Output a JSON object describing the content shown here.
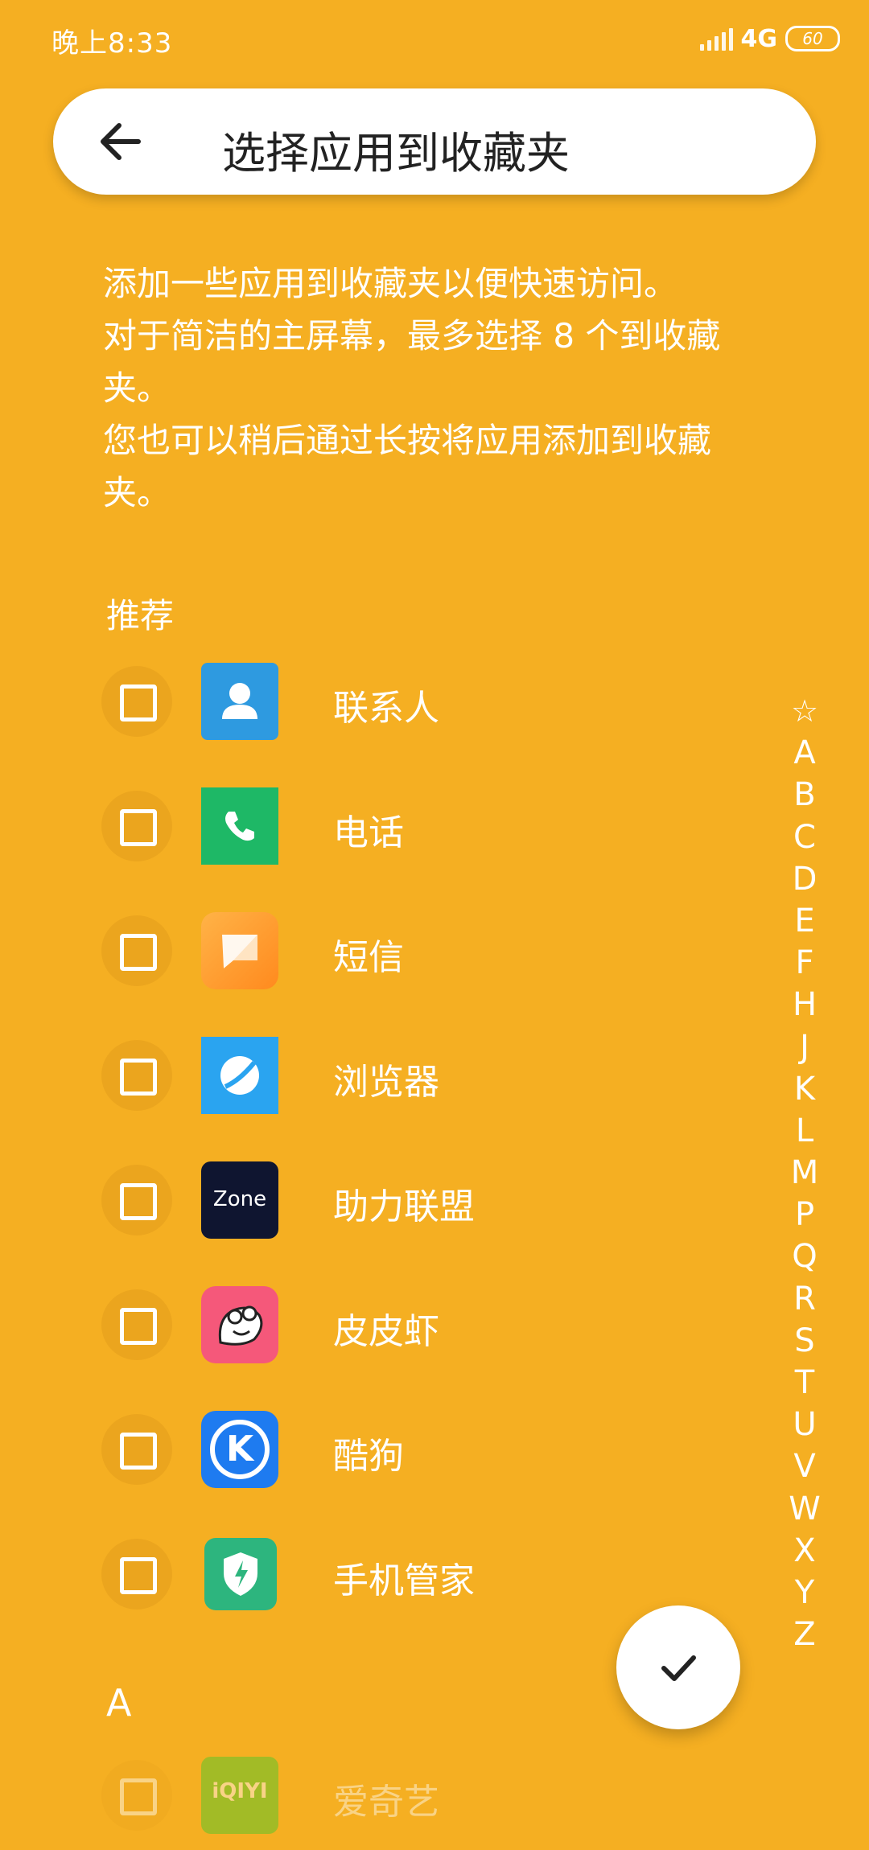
{
  "status_bar": {
    "time": "晚上8:33",
    "network": "4G",
    "battery": "60"
  },
  "header": {
    "title": "选择应用到收藏夹"
  },
  "description": {
    "line1": "添加一些应用到收藏夹以便快速访问。",
    "line2": "对于简洁的主屏幕，最多选择 8 个到收藏夹。",
    "line3": "您也可以稍后通过长按将应用添加到收藏夹。"
  },
  "sections": {
    "recommended": "推荐",
    "a": "A"
  },
  "apps": [
    {
      "label": "联系人",
      "icon": "contacts-icon",
      "color": "#2E9AE0"
    },
    {
      "label": "电话",
      "icon": "phone-icon",
      "color": "#1EB866"
    },
    {
      "label": "短信",
      "icon": "messages-icon",
      "color": "#FF9A2E"
    },
    {
      "label": "浏览器",
      "icon": "browser-icon",
      "color": "#2AA4F0"
    },
    {
      "label": "助力联盟",
      "icon": "zone-icon",
      "color": "#0F1530"
    },
    {
      "label": "皮皮虾",
      "icon": "pipixia-icon",
      "color": "#F5587A"
    },
    {
      "label": "酷狗",
      "icon": "kugou-icon",
      "color": "#1E7BF0"
    },
    {
      "label": "手机管家",
      "icon": "security-icon",
      "color": "#2DB57E"
    },
    {
      "label": "爱奇艺",
      "icon": "iqiyi-icon",
      "color": "#3FCB2D"
    }
  ],
  "zone_icon_text": "Zone",
  "kugou_icon_text": "K",
  "iqiyi_icon_text": "iQIYI",
  "alphabet": [
    "☆",
    "A",
    "B",
    "C",
    "D",
    "E",
    "F",
    "H",
    "J",
    "K",
    "L",
    "M",
    "P",
    "Q",
    "R",
    "S",
    "T",
    "U",
    "V",
    "W",
    "X",
    "Y",
    "Z"
  ]
}
